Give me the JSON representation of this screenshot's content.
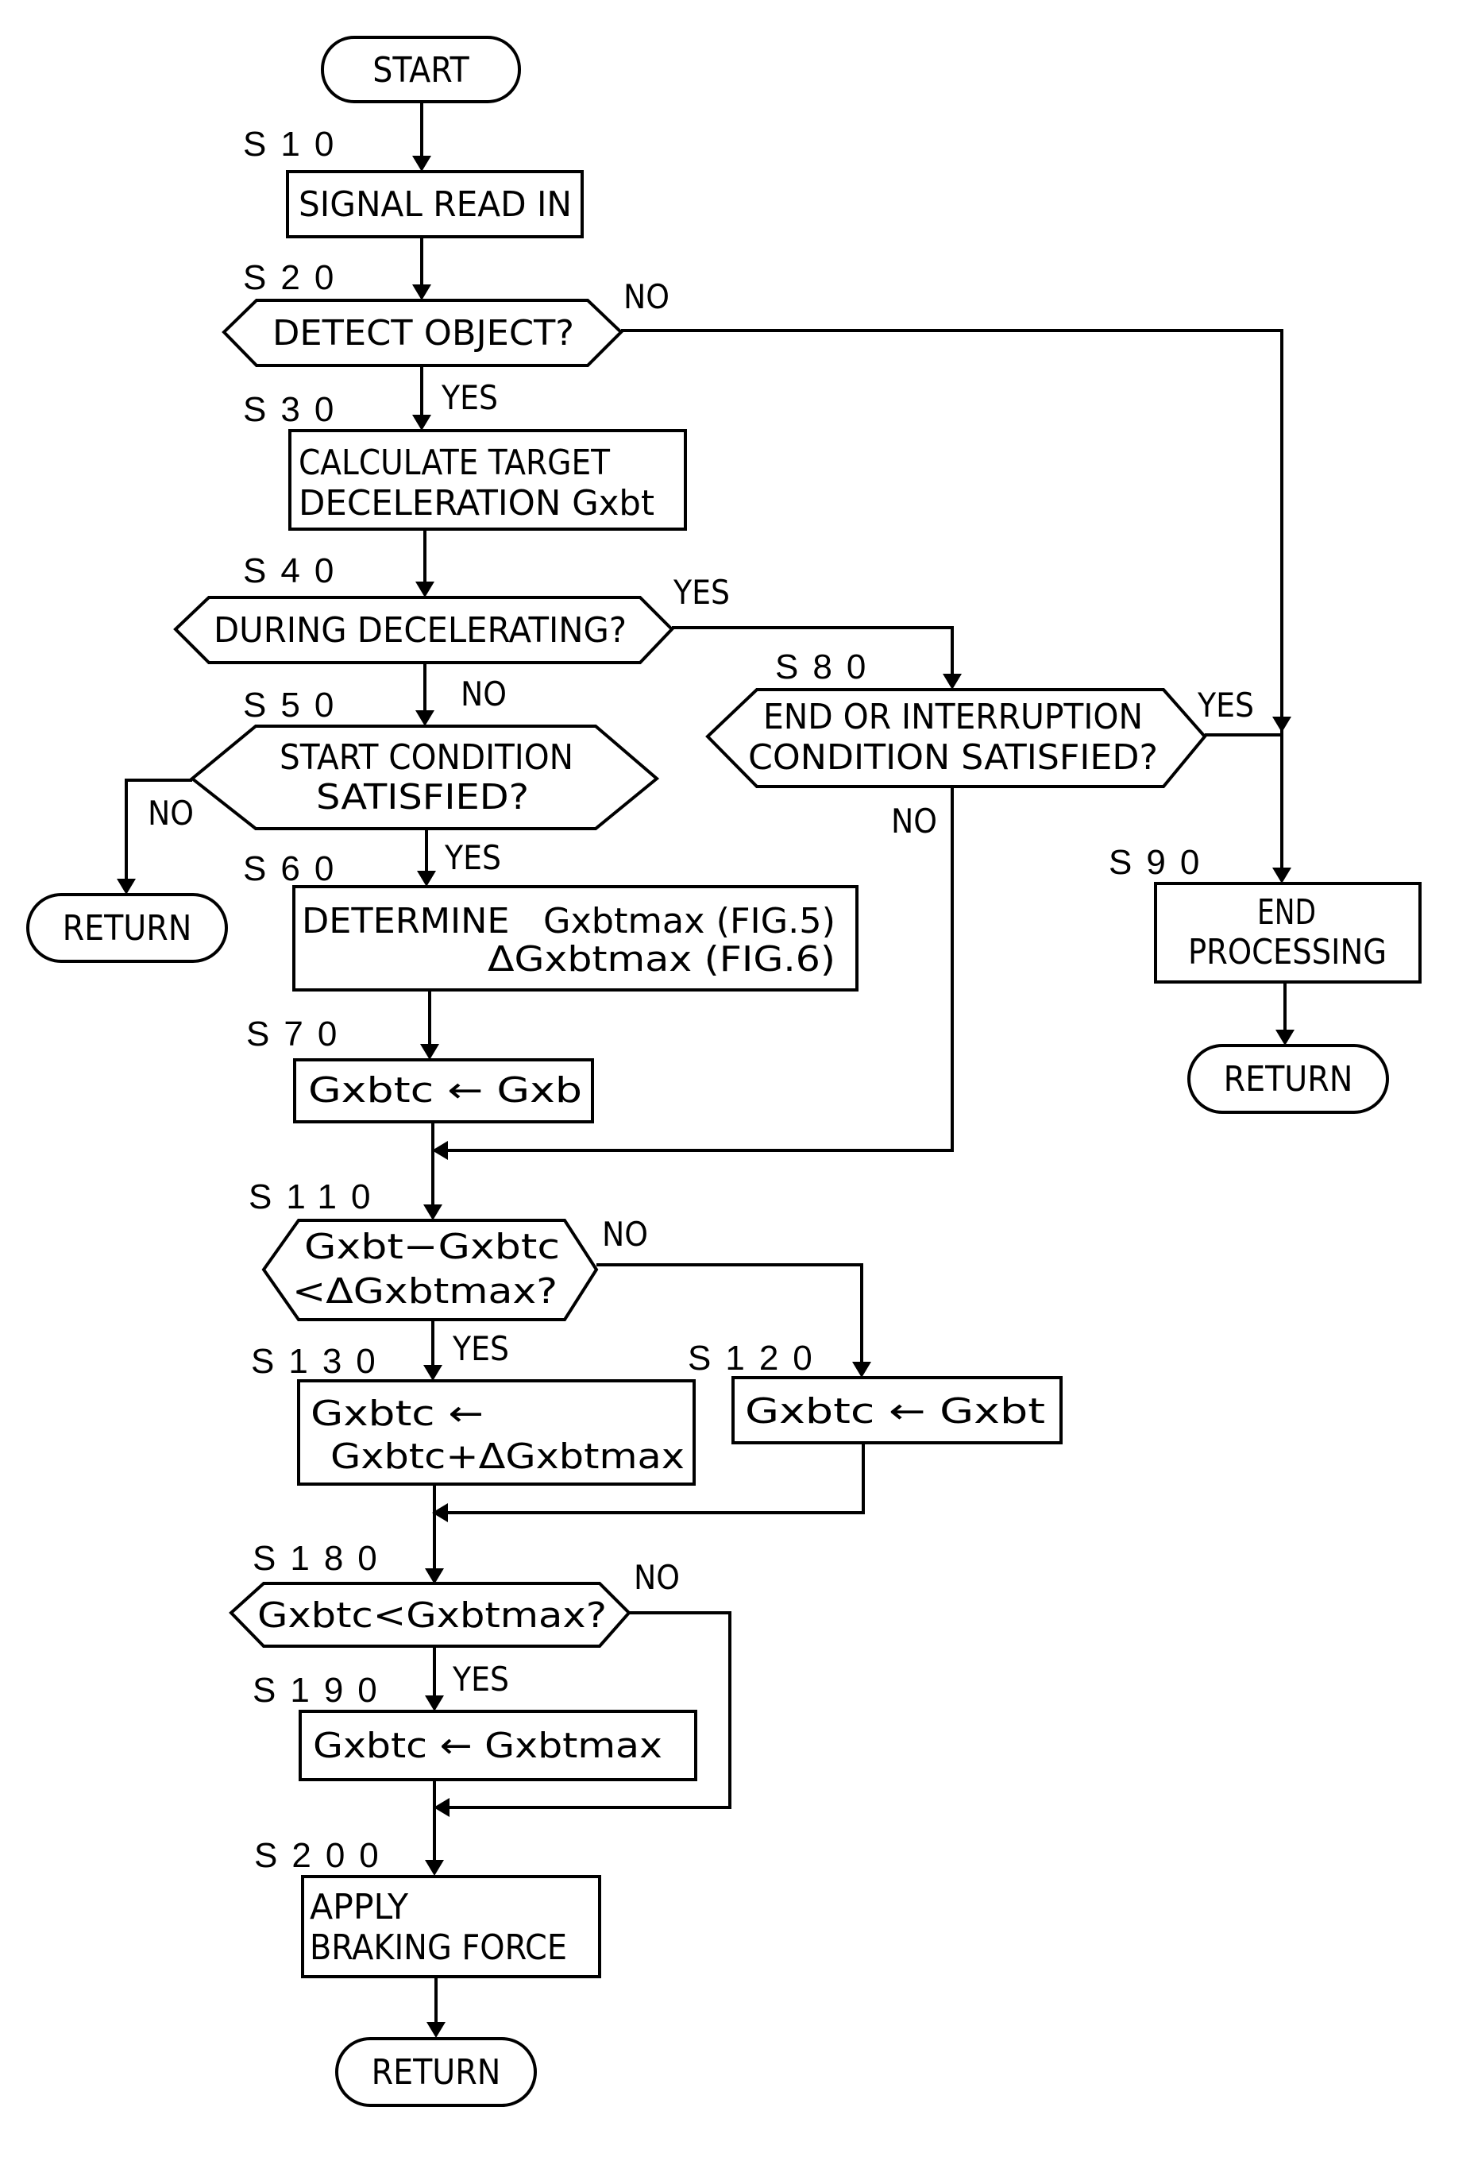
{
  "figure": {
    "type": "flowchart",
    "nodes": {
      "start": {
        "text": "START"
      },
      "s10": {
        "step": "S10",
        "lines": [
          "SIGNAL READ IN"
        ]
      },
      "s20": {
        "step": "S20",
        "lines": [
          "DETECT OBJECT?"
        ],
        "yes": "YES",
        "no": "NO"
      },
      "s30": {
        "step": "S30",
        "lines": [
          "CALCULATE TARGET",
          "DECELERATION Gxbt"
        ]
      },
      "s40": {
        "step": "S40",
        "lines": [
          "DURING DECELERATING?"
        ],
        "yes": "YES",
        "no": "NO"
      },
      "s50": {
        "step": "S50",
        "lines": [
          "START CONDITION",
          "SATISFIED?"
        ],
        "yes": "YES",
        "no": "NO"
      },
      "return_left": {
        "text": "RETURN"
      },
      "s60": {
        "step": "S60",
        "lines": [
          "DETERMINE   Gxbtmax (FIG.5)",
          "ΔGxbtmax (FIG.6)"
        ]
      },
      "s70": {
        "step": "S70",
        "lines": [
          "Gxbtc ← Gxb"
        ]
      },
      "s80": {
        "step": "S80",
        "lines": [
          "END OR INTERRUPTION",
          "CONDITION SATISFIED?"
        ],
        "yes": "YES",
        "no": "NO"
      },
      "s90": {
        "step": "S90",
        "lines": [
          "END",
          "PROCESSING"
        ]
      },
      "return_right": {
        "text": "RETURN"
      },
      "s110": {
        "step": "S110",
        "lines": [
          "Gxbt−Gxbtc",
          "<ΔGxbtmax?"
        ],
        "yes": "YES",
        "no": "NO"
      },
      "s120": {
        "step": "S120",
        "lines": [
          "Gxbtc ← Gxbt"
        ]
      },
      "s130": {
        "step": "S130",
        "lines": [
          "Gxbtc ←",
          "Gxbtc+ΔGxbtmax"
        ]
      },
      "s180": {
        "step": "S180",
        "lines": [
          "Gxbtc<Gxbtmax?"
        ],
        "yes": "YES",
        "no": "NO"
      },
      "s190": {
        "step": "S190",
        "lines": [
          "Gxbtc ← Gxbtmax"
        ]
      },
      "s200": {
        "step": "S200",
        "lines": [
          "APPLY",
          "BRAKING FORCE"
        ]
      },
      "return_bottom": {
        "text": "RETURN"
      }
    },
    "edges": [
      {
        "from": "start",
        "to": "s10"
      },
      {
        "from": "s10",
        "to": "s20"
      },
      {
        "from": "s20",
        "to": "s30",
        "label": "YES"
      },
      {
        "from": "s20",
        "to": "s90",
        "label": "NO"
      },
      {
        "from": "s30",
        "to": "s40"
      },
      {
        "from": "s40",
        "to": "s50",
        "label": "NO"
      },
      {
        "from": "s40",
        "to": "s80",
        "label": "YES"
      },
      {
        "from": "s50",
        "to": "s60",
        "label": "YES"
      },
      {
        "from": "s50",
        "to": "return_left",
        "label": "NO"
      },
      {
        "from": "s60",
        "to": "s70"
      },
      {
        "from": "s70",
        "to": "s110"
      },
      {
        "from": "s80",
        "to": "s90",
        "label": "YES"
      },
      {
        "from": "s80",
        "to": "s110",
        "label": "NO"
      },
      {
        "from": "s90",
        "to": "return_right"
      },
      {
        "from": "s110",
        "to": "s130",
        "label": "YES"
      },
      {
        "from": "s110",
        "to": "s120",
        "label": "NO"
      },
      {
        "from": "s130",
        "to": "s180"
      },
      {
        "from": "s120",
        "to": "s180"
      },
      {
        "from": "s180",
        "to": "s190",
        "label": "YES"
      },
      {
        "from": "s180",
        "to": "s200",
        "label": "NO"
      },
      {
        "from": "s190",
        "to": "s200"
      },
      {
        "from": "s200",
        "to": "return_bottom"
      }
    ]
  }
}
